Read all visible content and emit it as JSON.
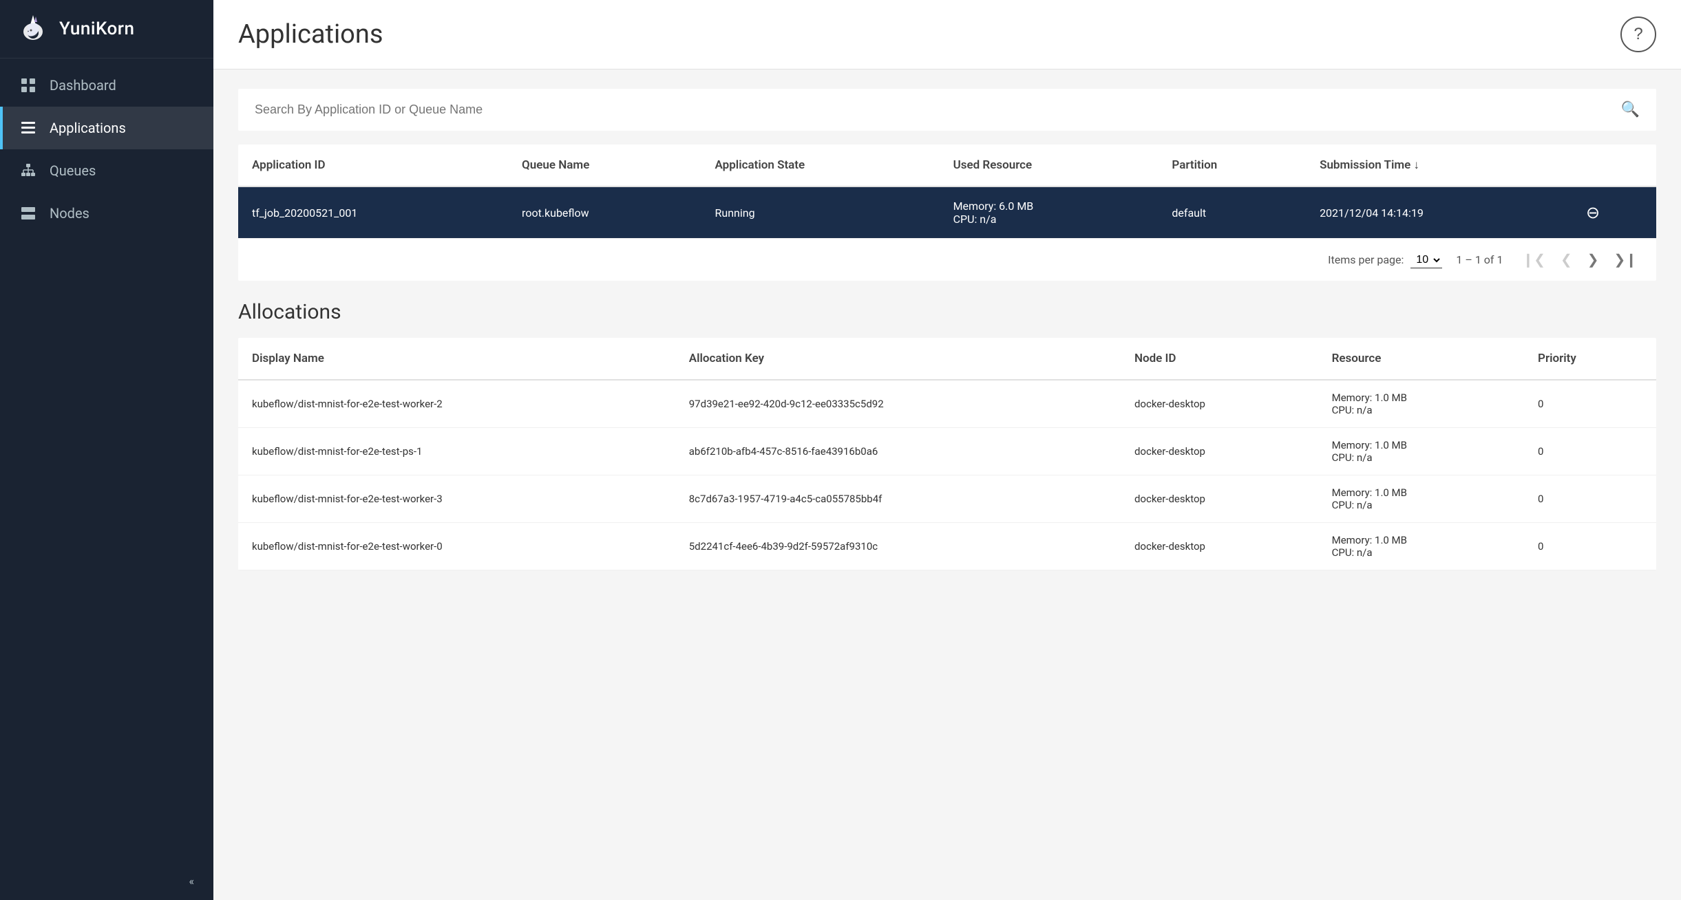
{
  "sidebar": {
    "logo_text": "YuniKorn",
    "nav_items": [
      {
        "id": "dashboard",
        "label": "Dashboard",
        "icon": "grid",
        "active": false
      },
      {
        "id": "applications",
        "label": "Applications",
        "icon": "list",
        "active": true
      },
      {
        "id": "queues",
        "label": "Queues",
        "icon": "hierarchy",
        "active": false
      },
      {
        "id": "nodes",
        "label": "Nodes",
        "icon": "server",
        "active": false
      }
    ],
    "collapse_label": "«"
  },
  "header": {
    "title": "Applications",
    "help_label": "?"
  },
  "search": {
    "placeholder": "Search By Application ID or Queue Name"
  },
  "applications_table": {
    "columns": [
      {
        "id": "app_id",
        "label": "Application ID"
      },
      {
        "id": "queue_name",
        "label": "Queue Name"
      },
      {
        "id": "app_state",
        "label": "Application State"
      },
      {
        "id": "used_resource",
        "label": "Used Resource"
      },
      {
        "id": "partition",
        "label": "Partition"
      },
      {
        "id": "submission_time",
        "label": "Submission Time ↓"
      }
    ],
    "rows": [
      {
        "app_id": "tf_job_20200521_001",
        "queue_name": "root.kubeflow",
        "app_state": "Running",
        "used_resource_line1": "Memory: 6.0 MB",
        "used_resource_line2": "CPU: n/a",
        "partition": "default",
        "submission_time": "2021/12/04 14:14:19",
        "selected": true
      }
    ],
    "pagination": {
      "items_per_page_label": "Items per page:",
      "items_per_page_value": "10",
      "page_info": "1 – 1 of 1"
    }
  },
  "allocations": {
    "title": "Allocations",
    "columns": [
      {
        "id": "display_name",
        "label": "Display Name"
      },
      {
        "id": "allocation_key",
        "label": "Allocation Key"
      },
      {
        "id": "node_id",
        "label": "Node ID"
      },
      {
        "id": "resource",
        "label": "Resource"
      },
      {
        "id": "priority",
        "label": "Priority"
      }
    ],
    "rows": [
      {
        "display_name": "kubeflow/dist-mnist-for-e2e-test-worker-2",
        "allocation_key": "97d39e21-ee92-420d-9c12-ee03335c5d92",
        "node_id": "docker-desktop",
        "resource_line1": "Memory: 1.0 MB",
        "resource_line2": "CPU: n/a",
        "priority": "0"
      },
      {
        "display_name": "kubeflow/dist-mnist-for-e2e-test-ps-1",
        "allocation_key": "ab6f210b-afb4-457c-8516-fae43916b0a6",
        "node_id": "docker-desktop",
        "resource_line1": "Memory: 1.0 MB",
        "resource_line2": "CPU: n/a",
        "priority": "0"
      },
      {
        "display_name": "kubeflow/dist-mnist-for-e2e-test-worker-3",
        "allocation_key": "8c7d67a3-1957-4719-a4c5-ca055785bb4f",
        "node_id": "docker-desktop",
        "resource_line1": "Memory: 1.0 MB",
        "resource_line2": "CPU: n/a",
        "priority": "0"
      },
      {
        "display_name": "kubeflow/dist-mnist-for-e2e-test-worker-0",
        "allocation_key": "5d2241cf-4ee6-4b39-9d2f-59572af9310c",
        "node_id": "docker-desktop",
        "resource_line1": "Memory: 1.0 MB",
        "resource_line2": "CPU: n/a",
        "priority": "0"
      }
    ]
  }
}
